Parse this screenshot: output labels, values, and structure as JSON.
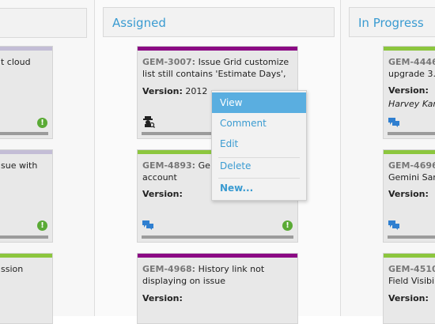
{
  "columns": [
    {
      "title": ""
    },
    {
      "title": "Assigned"
    },
    {
      "title": "In Progress"
    }
  ],
  "cards": {
    "left": [
      {
        "title_tail": "t cloud"
      },
      {
        "title_tail": "sue with"
      },
      {
        "title_tail": "ssion"
      }
    ],
    "assigned": [
      {
        "key": "GEM-3007:",
        "title": " Issue Grid customize list still contains 'Estimate Days',",
        "version_label": "Version:",
        "version_value": " 2012"
      },
      {
        "key": "GEM-4893:",
        "title": " Ge",
        "title_line2": "account",
        "version_label": "Version:",
        "version_value": ""
      },
      {
        "key": "GEM-4968:",
        "title": " History link not displaying on issue",
        "version_label": "Version:",
        "version_value": ""
      }
    ],
    "in_progress": [
      {
        "key": "GEM-4446",
        "line2": "upgrade 3.",
        "version_label": "Version:",
        "assignee": "Harvey Kand"
      },
      {
        "key": "GEM-4696",
        "line2": "Gemini Sar",
        "version_label": "Version:"
      },
      {
        "key": "GEM-4510",
        "line2": "Field Visibil",
        "version_label": "Version:"
      }
    ]
  },
  "context_menu": {
    "items": [
      {
        "label": "View"
      },
      {
        "label": "Comment"
      },
      {
        "label": "Edit"
      },
      {
        "label": "Delete"
      },
      {
        "label": "New..."
      }
    ]
  },
  "colors": {
    "purple": "#8b0a84",
    "green": "#8cc63e",
    "lavender": "#c3bdd6",
    "accent": "#3a9bd1",
    "priority": "#5aaa35"
  },
  "icons": {
    "priority": "!",
    "comment": "comment-icon",
    "agent": "agent-icon"
  }
}
